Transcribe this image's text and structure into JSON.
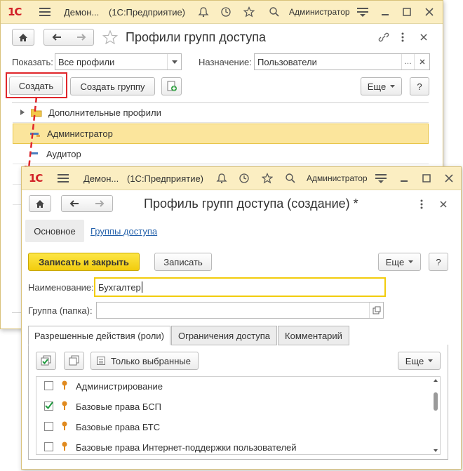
{
  "colors": {
    "accent_red": "#d11f26",
    "title_bar": "#fbeec2",
    "selection": "#fbe59c",
    "yellow_button": "#f2cc0d",
    "link": "#2461ab"
  },
  "back_window": {
    "app_short": "Демон...",
    "app_full": "(1С:Предприятие)",
    "user": "Администратор",
    "title": "Профили групп доступа",
    "show_label": "Показать:",
    "show_value": "Все профили",
    "purpose_label": "Назначение:",
    "purpose_value": "Пользователи",
    "create_button": "Создать",
    "create_group_button": "Создать группу",
    "more_button": "Еще",
    "help_button": "?",
    "list": [
      {
        "label": "Дополнительные профили",
        "icon": "folder-icon"
      },
      {
        "label": "Администратор",
        "icon": "profile-icon"
      },
      {
        "label": "Аудитор",
        "icon": "profile-icon"
      }
    ]
  },
  "front_window": {
    "app_short": "Демон...",
    "app_full": "(1С:Предприятие)",
    "user": "Администратор",
    "title": "Профиль групп доступа (создание) *",
    "tab_main": "Основное",
    "tab_groups": "Группы доступа",
    "save_close_button": "Записать и закрыть",
    "save_button": "Записать",
    "more_button": "Еще",
    "help_button": "?",
    "name_label": "Наименование:",
    "name_value": "Бухгалтер",
    "group_label": "Группа (папка):",
    "group_value": "",
    "tabs": [
      "Разрешенные действия (роли)",
      "Ограничения доступа",
      "Комментарий"
    ],
    "only_selected_button": "Только выбранные",
    "roles_more_button": "Еще",
    "roles": [
      {
        "label": "Администрирование",
        "checked": false
      },
      {
        "label": "Базовые права БСП",
        "checked": true
      },
      {
        "label": "Базовые права БТС",
        "checked": false
      },
      {
        "label": "Базовые права Интернет-поддержки пользователей",
        "checked": false
      }
    ]
  }
}
